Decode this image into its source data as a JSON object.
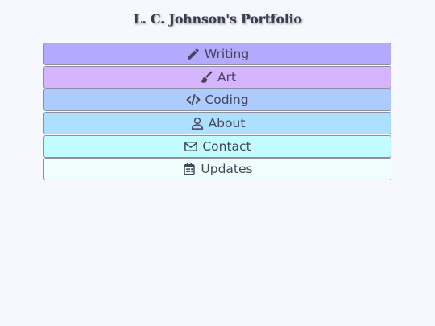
{
  "page": {
    "title": "L. C. Johnson's Portfolio"
  },
  "menu": {
    "items": [
      {
        "label": "Writing",
        "icon": "pencil-icon",
        "color": "#b3aafe"
      },
      {
        "label": "Art",
        "icon": "paintbrush-icon",
        "color": "#d5b4fe"
      },
      {
        "label": "Coding",
        "icon": "code-icon",
        "color": "#aecbfe"
      },
      {
        "label": "About",
        "icon": "user-icon",
        "color": "#addffe"
      },
      {
        "label": "Contact",
        "icon": "envelope-icon",
        "color": "#c2fcfd"
      },
      {
        "label": "Updates",
        "icon": "calendar-icon",
        "color": "#effefd"
      }
    ]
  }
}
